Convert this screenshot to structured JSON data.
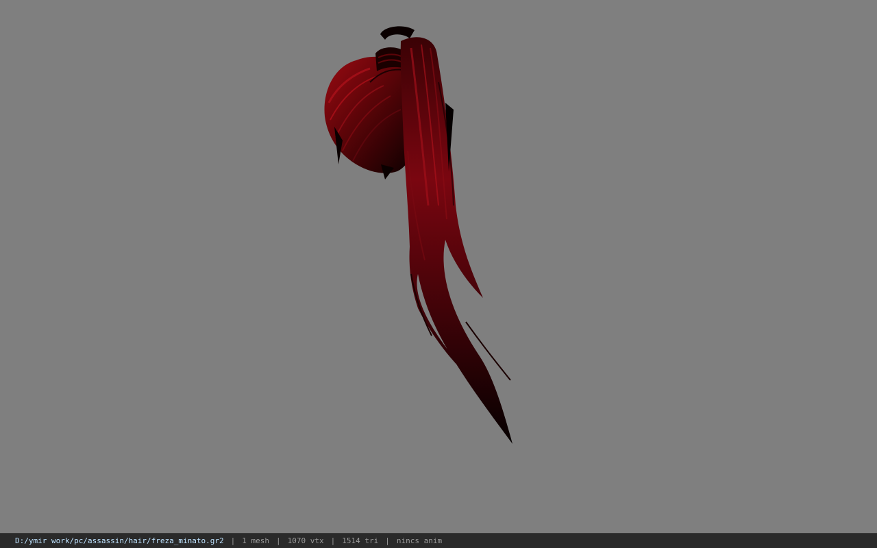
{
  "viewport": {
    "background_color": "#7f7f7f",
    "model": {
      "name": "hair-mesh",
      "hair_color_dark": "#0a0000",
      "hair_color_mid": "#5a0408",
      "hair_color_highlight": "#9a0a12"
    }
  },
  "status_bar": {
    "file_path": "D:/ymir work/pc/assassin/hair/freza_minato.gr2",
    "mesh_count": "1 mesh",
    "vertex_count": "1070 vtx",
    "triangle_count": "1514 tri",
    "anim_status": "nincs anim",
    "separator": "|",
    "path_color": "#bfe3ff",
    "text_color": "#9a9a9a",
    "background_color": "#2a2a2a"
  }
}
